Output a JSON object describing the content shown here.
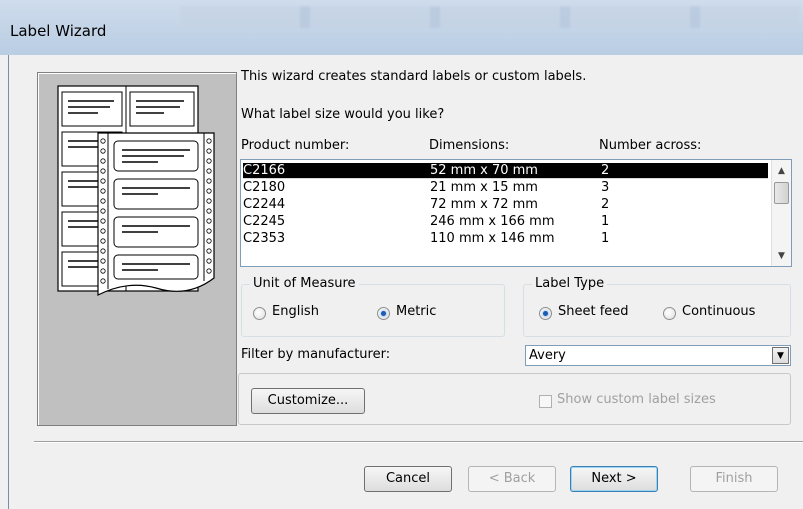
{
  "window": {
    "title": "Label Wizard"
  },
  "intro": {
    "line1": "This wizard creates standard labels or custom labels.",
    "line2": "What label size would you like?"
  },
  "columns": {
    "product": "Product number:",
    "dimensions": "Dimensions:",
    "across": "Number across:"
  },
  "labels": [
    {
      "product": "C2166",
      "dimensions": "52 mm x 70 mm",
      "across": "2",
      "selected": true
    },
    {
      "product": "C2180",
      "dimensions": "21 mm x 15 mm",
      "across": "3",
      "selected": false
    },
    {
      "product": "C2244",
      "dimensions": "72 mm x 72 mm",
      "across": "2",
      "selected": false
    },
    {
      "product": "C2245",
      "dimensions": "246 mm x 166 mm",
      "across": "1",
      "selected": false
    },
    {
      "product": "C2353",
      "dimensions": "110 mm x 146 mm",
      "across": "1",
      "selected": false
    }
  ],
  "unit_of_measure": {
    "legend": "Unit of Measure",
    "english": "English",
    "metric": "Metric",
    "selected": "metric"
  },
  "label_type": {
    "legend": "Label Type",
    "sheet_feed": "Sheet feed",
    "continuous": "Continuous",
    "selected": "sheet_feed"
  },
  "filter": {
    "label": "Filter by  manufacturer:",
    "value": "Avery"
  },
  "customize": {
    "button": "Customize...",
    "show_custom": "Show custom label sizes",
    "show_custom_checked": false
  },
  "buttons": {
    "cancel": "Cancel",
    "back": "< Back",
    "next": "Next >",
    "finish": "Finish"
  },
  "icons": {
    "scroll_up": "▲",
    "scroll_down": "▼",
    "dropdown": "▼"
  },
  "colors": {
    "selection": "#000000",
    "radio_dot": "#1c5db4",
    "illustration_bg": "#c0c0c0"
  }
}
